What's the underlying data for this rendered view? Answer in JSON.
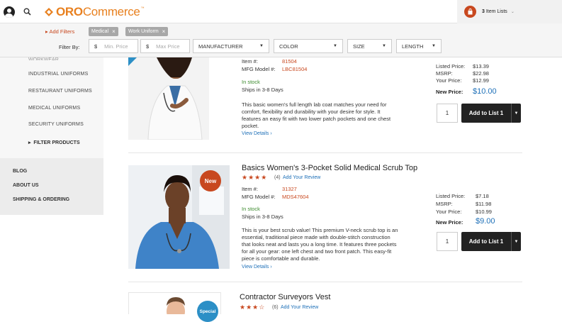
{
  "brand": {
    "name_bold": "ORO",
    "name_rest": "Commerce",
    "tm": "™"
  },
  "header": {
    "item_lists_count": "3",
    "item_lists_label": "Item Lists"
  },
  "filters": {
    "add_label": "Add Filters",
    "chips": [
      {
        "label": "Medical"
      },
      {
        "label": "Work Uniform"
      }
    ],
    "filter_by": "Filter By:",
    "currency": "$",
    "min_placeholder": "Min. Price",
    "max_placeholder": "Max Price",
    "dropdowns": [
      "MANUFACTURER",
      "COLOR",
      "SIZE",
      "LENGTH"
    ]
  },
  "sidebar": {
    "cut_item": "WORKWEAR",
    "items": [
      "INDUSTRIAL UNIFORMS",
      "RESTAURANT UNIFORMS",
      "MEDICAL UNIFORMS",
      "SECURITY UNIFORMS"
    ],
    "filter_products": "FILTER PRODUCTS",
    "links": [
      "BLOG",
      "ABOUT US",
      "SHIPPING & ORDERING"
    ]
  },
  "products": [
    {
      "item_label": "Item #:",
      "item": "81504",
      "mfg_label": "MFG Model #:",
      "mfg": "LBC81504",
      "stock": "In stock",
      "ships": "Ships in 3-8 Days",
      "desc": [
        "This basic women's full length lab coat matches your need for",
        "comfort, flexibility and durability with your desire for style. It",
        "features an easy fit with two lower patch pockets and one chest",
        "pocket."
      ],
      "view": "View Details ›",
      "listed_label": "Listed Price:",
      "listed": "$13.39",
      "msrp_label": "MSRP:",
      "msrp": "$22.98",
      "your_label": "Your Price:",
      "your": "$12.99",
      "new_label": "New Price:",
      "new": "$10.00",
      "qty": "1",
      "add": "Add to List 1"
    },
    {
      "title": "Basics Women's 3-Pocket Solid Medical Scrub Top",
      "stars": "★★★★",
      "count": "(4)",
      "review": "Add Your Review",
      "badge": "New",
      "item_label": "Item #:",
      "item": "31327",
      "mfg_label": "MFG Model #:",
      "mfg": "MDS47604",
      "stock": "In stock",
      "ships": "Ships in 3-8 Days",
      "desc": [
        "This is your best scrub value! This premium V-neck scrub top is an",
        "essential, traditional piece made with double-stitch construction",
        "that looks neat and lasts you a long time. It features three pockets",
        "for all your gear: one left chest and two front patch. This easy-fit",
        "piece is comfortable and durable."
      ],
      "view": "View Details ›",
      "listed_label": "Listed Price:",
      "listed": "$7.18",
      "msrp_label": "MSRP:",
      "msrp": "$11.98",
      "your_label": "Your Price:",
      "your": "$10.99",
      "new_label": "New Price:",
      "new": "$9.00",
      "qty": "1",
      "add": "Add to List 1"
    },
    {
      "title": "Contractor Surveyors Vest",
      "stars": "★★★☆",
      "count": "(6)",
      "review": "Add Your Review",
      "badge": "Special"
    }
  ],
  "colors": {
    "accent": "#c8481f",
    "link": "#1e70b8",
    "stock": "#3c8b2e",
    "brand": "#e8801f"
  }
}
